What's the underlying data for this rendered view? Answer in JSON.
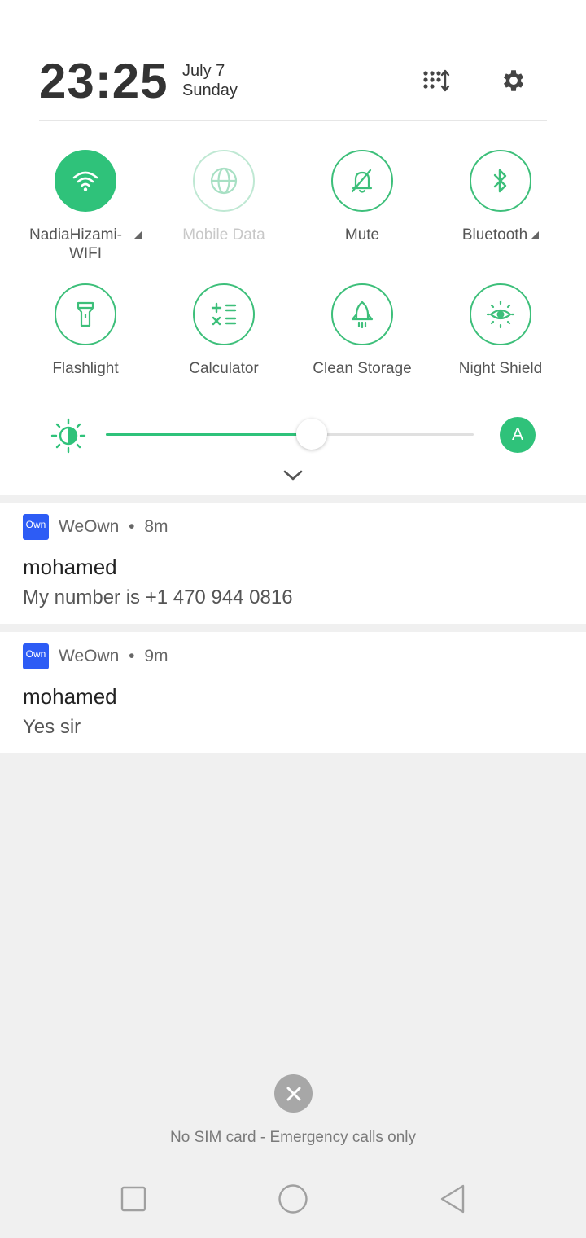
{
  "header": {
    "time": "23:25",
    "date_line1": "July 7",
    "date_line2": "Sunday",
    "edit_icon": "edit-tiles-icon",
    "settings_icon": "gear-icon"
  },
  "tiles": [
    {
      "label": "NadiaHizami-",
      "label2": "WIFI",
      "icon": "wifi-icon",
      "state": "active"
    },
    {
      "label": "Mobile Data",
      "icon": "globe-icon",
      "state": "disabled"
    },
    {
      "label": "Mute",
      "icon": "bell-off-icon",
      "state": "off"
    },
    {
      "label": "Bluetooth",
      "icon": "bluetooth-icon",
      "state": "off"
    },
    {
      "label": "Flashlight",
      "icon": "flashlight-icon",
      "state": "off"
    },
    {
      "label": "Calculator",
      "icon": "calculator-icon",
      "state": "off"
    },
    {
      "label": "Clean Storage",
      "icon": "rocket-icon",
      "state": "off"
    },
    {
      "label": "Night Shield",
      "icon": "eye-sun-icon",
      "state": "off"
    }
  ],
  "brightness": {
    "level": 0.56,
    "auto_label": "A",
    "accent": "#2fc27a"
  },
  "notifications": [
    {
      "app": "WeOwn",
      "app_icon_text": "Own",
      "sep": "•",
      "time": "8m",
      "title": "mohamed",
      "body": "My number is +1 470 944 0816"
    },
    {
      "app": "WeOwn",
      "app_icon_text": "Own",
      "sep": "•",
      "time": "9m",
      "title": "mohamed",
      "body": "Yes sir"
    }
  ],
  "status": {
    "sim_text": "No SIM card - Emergency calls only"
  }
}
